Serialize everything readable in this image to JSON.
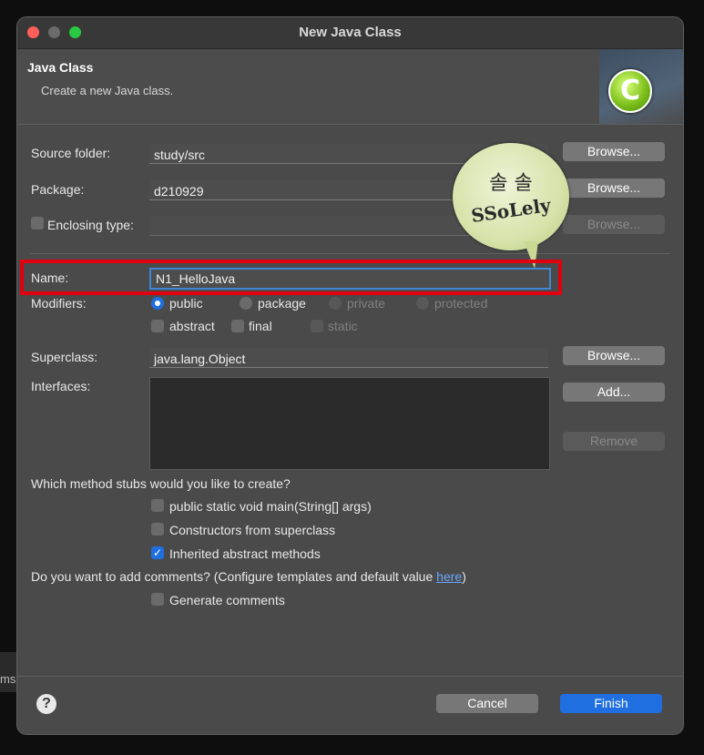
{
  "window": {
    "title": "New Java Class"
  },
  "header": {
    "title": "Java Class",
    "subtitle": "Create a new Java class."
  },
  "form": {
    "source_folder": {
      "label": "Source folder:",
      "value": "study/src",
      "button": "Browse..."
    },
    "package": {
      "label": "Package:",
      "value": "d210929",
      "button": "Browse..."
    },
    "enclosing_type": {
      "label": "Enclosing type:",
      "value": "",
      "button": "Browse...",
      "checked": false
    },
    "name": {
      "label": "Name:",
      "value": "N1_HelloJava"
    },
    "modifiers": {
      "label": "Modifiers:",
      "access": [
        "public",
        "package",
        "private",
        "protected"
      ],
      "selected": "public",
      "flags": [
        "abstract",
        "final",
        "static"
      ]
    },
    "superclass": {
      "label": "Superclass:",
      "value": "java.lang.Object",
      "button": "Browse..."
    },
    "interfaces": {
      "label": "Interfaces:",
      "add_button": "Add...",
      "remove_button": "Remove"
    },
    "stubs": {
      "question": "Which method stubs would you like to create?",
      "options": [
        {
          "label": "public static void main(String[] args)",
          "checked": false
        },
        {
          "label": "Constructors from superclass",
          "checked": false
        },
        {
          "label": "Inherited abstract methods",
          "checked": true
        }
      ]
    },
    "comments": {
      "question_prefix": "Do you want to add comments? (Configure templates and default value ",
      "link": "here",
      "question_suffix": ")",
      "option": "Generate comments",
      "checked": false
    }
  },
  "footer": {
    "cancel": "Cancel",
    "finish": "Finish",
    "help_icon": "?"
  },
  "watermark": {
    "line1": "솔 솔",
    "line2": "SSoLely"
  },
  "backdrop": {
    "fragment": "ms"
  },
  "colors": {
    "accent": "#1f6fe0",
    "highlight": "#e0000f"
  }
}
